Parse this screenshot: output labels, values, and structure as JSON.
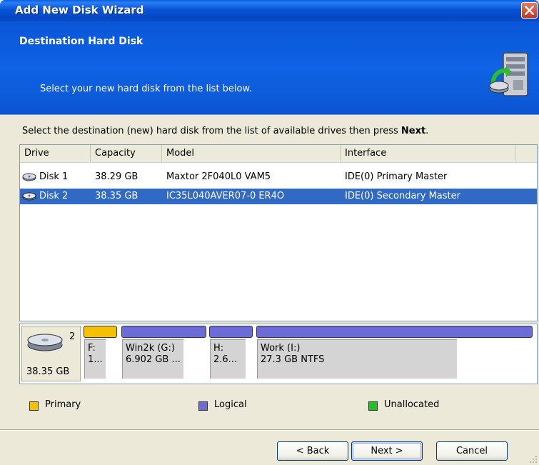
{
  "window": {
    "title": "Add New Disk Wizard"
  },
  "header": {
    "title": "Destination Hard Disk",
    "subtitle": "Select your new hard disk from the list below.",
    "icon": "server-disk-icon"
  },
  "instruction": {
    "text": "Select the destination (new) hard disk from the list of available drives then press ",
    "bold": "Next",
    "end": "."
  },
  "table": {
    "columns": [
      "Drive",
      "Capacity",
      "Model",
      "Interface"
    ],
    "rows": [
      {
        "drive": "Disk 1",
        "capacity": "38.29 GB",
        "model": "Maxtor 2F040L0 VAM5",
        "interface": "IDE(0) Primary Master",
        "selected": false
      },
      {
        "drive": "Disk 2",
        "capacity": "38.35 GB",
        "model": "IC35L040AVER07-0 ER4O",
        "interface": "IDE(0) Secondary Master",
        "selected": true
      }
    ]
  },
  "diskmap": {
    "disk_number": "2",
    "disk_size": "38.35 GB",
    "partitions": [
      {
        "line1": "F:",
        "line2": "1...",
        "type": "primary"
      },
      {
        "line1": "Win2k (G:)",
        "line2": "6.902 GB ...",
        "type": "logical"
      },
      {
        "line1": "H:",
        "line2": "2.6...",
        "type": "logical"
      },
      {
        "line1": "Work (I:)",
        "line2": "27.3 GB  NTFS",
        "type": "logical"
      }
    ]
  },
  "legend": {
    "primary": {
      "label": "Primary",
      "color": "#f5c000"
    },
    "logical": {
      "label": "Logical",
      "color": "#6c6cd9"
    },
    "unallocated": {
      "label": "Unallocated",
      "color": "#22c022"
    }
  },
  "buttons": {
    "back": "< Back",
    "next": "Next >",
    "cancel": "Cancel"
  },
  "colors": {
    "header_blue": "#0a56d8",
    "selection_blue": "#316ac5",
    "primary_bar": "#f5c000",
    "logical_bar": "#6c6cd9"
  }
}
